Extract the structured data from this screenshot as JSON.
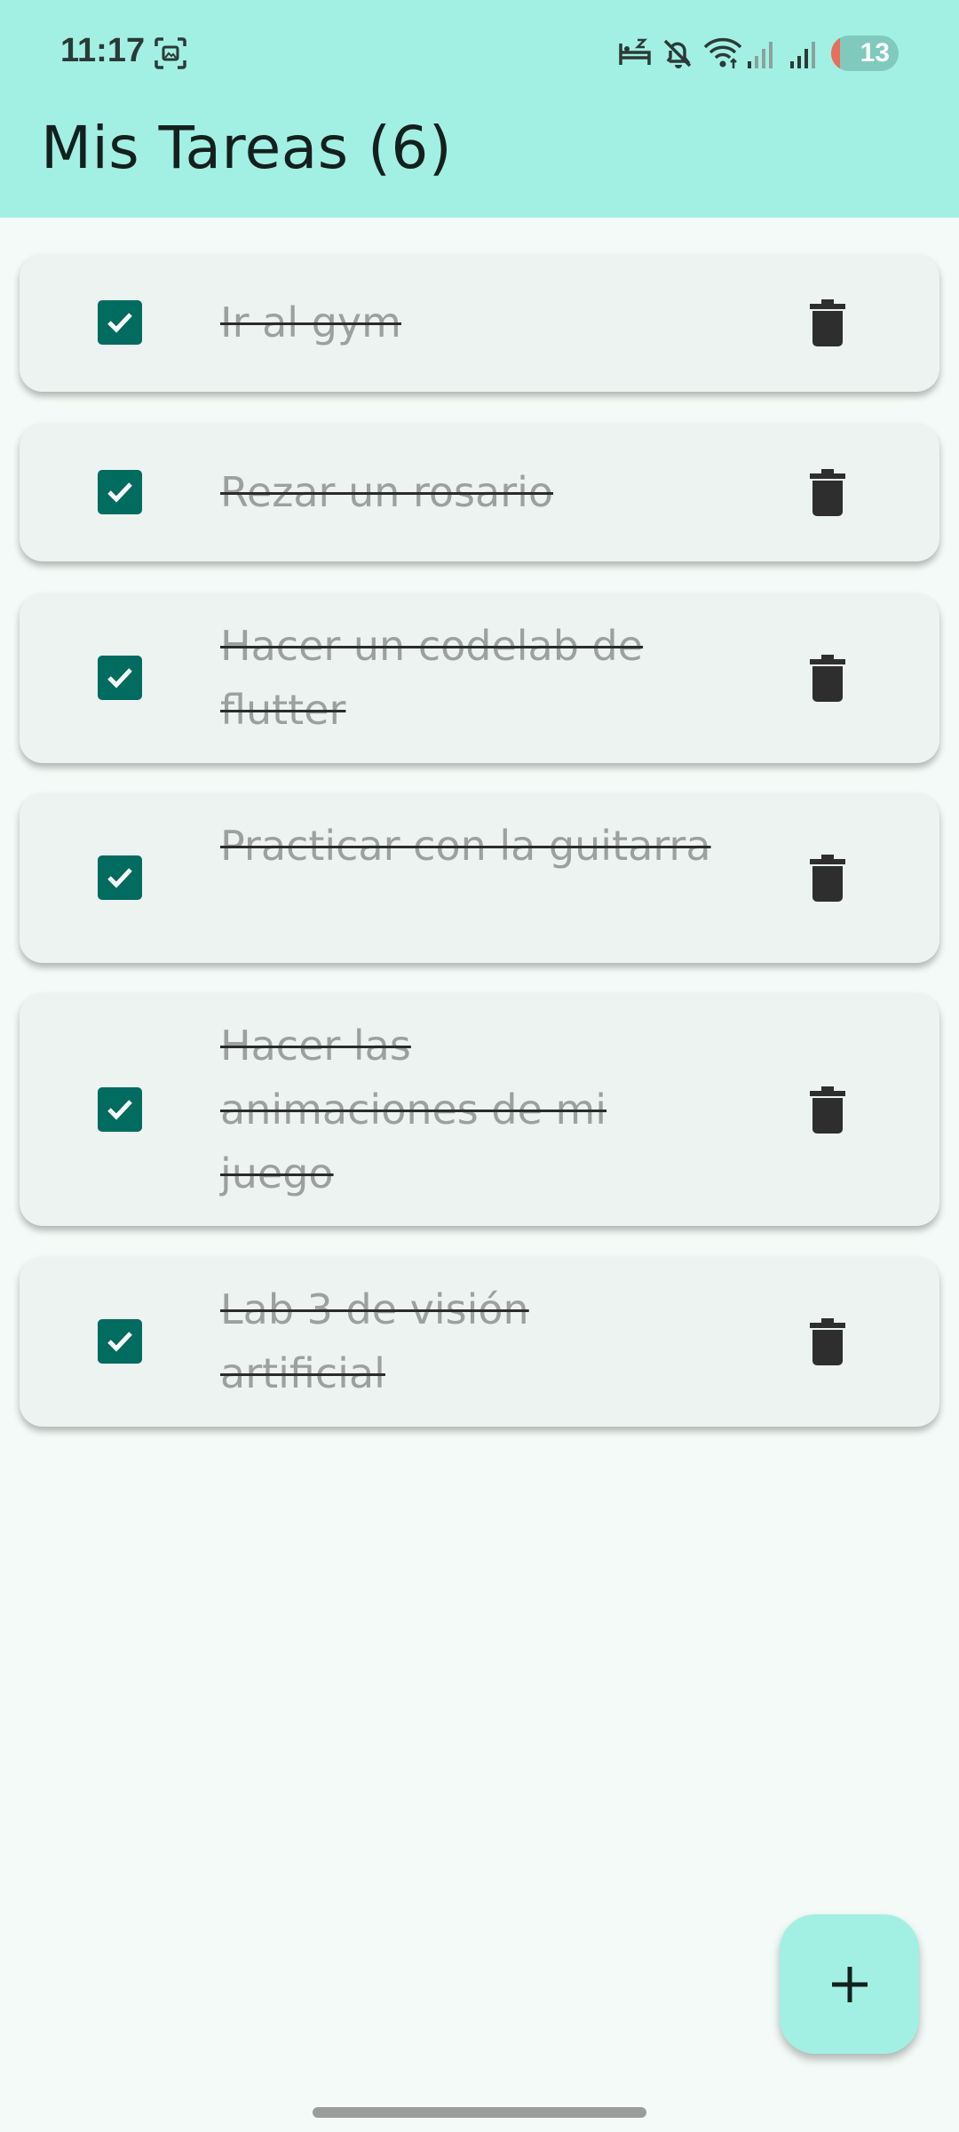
{
  "status_bar": {
    "time": "11:17",
    "battery": "13",
    "battery_level_percent": 13,
    "icons": [
      "screenshot-icon",
      "sleep-mode-icon",
      "mute-icon",
      "wifi-icon",
      "signal-1-icon",
      "signal-2-icon"
    ]
  },
  "app_bar": {
    "title": "Mis Tareas (6)",
    "background_color": "#a2f0e3"
  },
  "tasks": [
    {
      "text": "Ir al gym",
      "done": true
    },
    {
      "text": "Rezar un rosario",
      "done": true
    },
    {
      "text": "Hacer un codelab de flutter",
      "done": true
    },
    {
      "text": "Practicar con la guitarra",
      "done": true
    },
    {
      "text": "Hacer las animaciones de mi juego",
      "done": true
    },
    {
      "text": "Lab 3 de visión artificial",
      "done": true
    }
  ],
  "fab": {
    "icon": "plus-icon"
  },
  "colors": {
    "accent": "#a2f0e3",
    "checkbox": "#006b5f",
    "card": "#ecf3f1",
    "background": "#f3faf7"
  }
}
